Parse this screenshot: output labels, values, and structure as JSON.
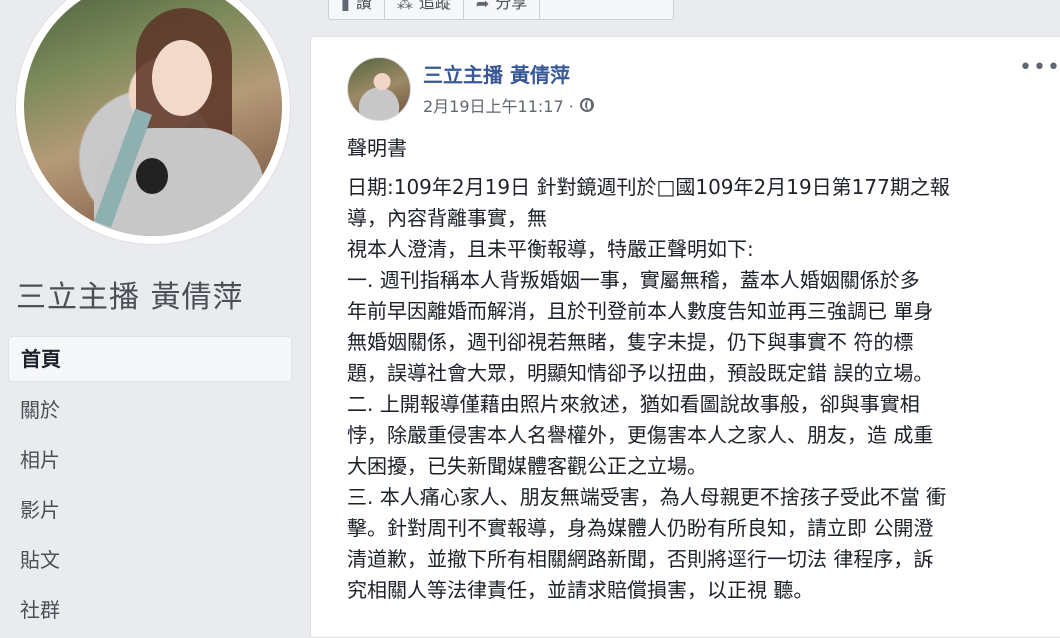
{
  "page": {
    "name": "三立主播 黃倩萍"
  },
  "nav": {
    "items": [
      {
        "label": "首頁",
        "active": true
      },
      {
        "label": "關於"
      },
      {
        "label": "相片"
      },
      {
        "label": "影片"
      },
      {
        "label": "貼文"
      },
      {
        "label": "社群"
      }
    ]
  },
  "actions": {
    "items": [
      {
        "icon": "like-icon",
        "label": "讚"
      },
      {
        "icon": "follow-icon",
        "label": "追蹤"
      },
      {
        "icon": "share-icon",
        "label": "分享"
      },
      {
        "icon": "more-icon",
        "label": ""
      }
    ]
  },
  "post": {
    "author": "三立主播 黃倩萍",
    "timestamp": "2月19日上午11:17 ·",
    "privacy_icon": "globe-icon",
    "more_label": "•••",
    "heading": "聲明書",
    "lines": [
      "日期:109年2月19日 針對鏡週刊於□國109年2月19日第177期之報",
      "導，內容背離事實，無",
      "視本人澄清，且未平衡報導，特嚴正聲明如下:",
      "一. 週刊指稱本人背叛婚姻一事，實屬無稽，蓋本人婚姻關係於多",
      "年前早因離婚而解消，且於刊登前本人數度告知並再三強調已 單身",
      "無婚姻關係，週刊卻視若無睹，隻字未提，仍下與事實不 符的標",
      "題，誤導社會大眾，明顯知情卻予以扭曲，預設既定錯 誤的立場。",
      "二. 上開報導僅藉由照片來敘述，猶如看圖說故事般，卻與事實相",
      "悖，除嚴重侵害本人名譽權外，更傷害本人之家人、朋友，造 成重",
      "大困擾，已失新聞媒體客觀公正之立場。",
      "三. 本人痛心家人、朋友無端受害，為人母親更不捨孩子受此不當 衝",
      "擊。針對周刊不實報導，身為媒體人仍盼有所良知，請立即 公開澄",
      "清道歉，並撤下所有相關網路新聞，否則將逕行一切法 律程序，訴",
      "究相關人等法律責任，並請求賠償損害，以正視 聽。"
    ]
  }
}
